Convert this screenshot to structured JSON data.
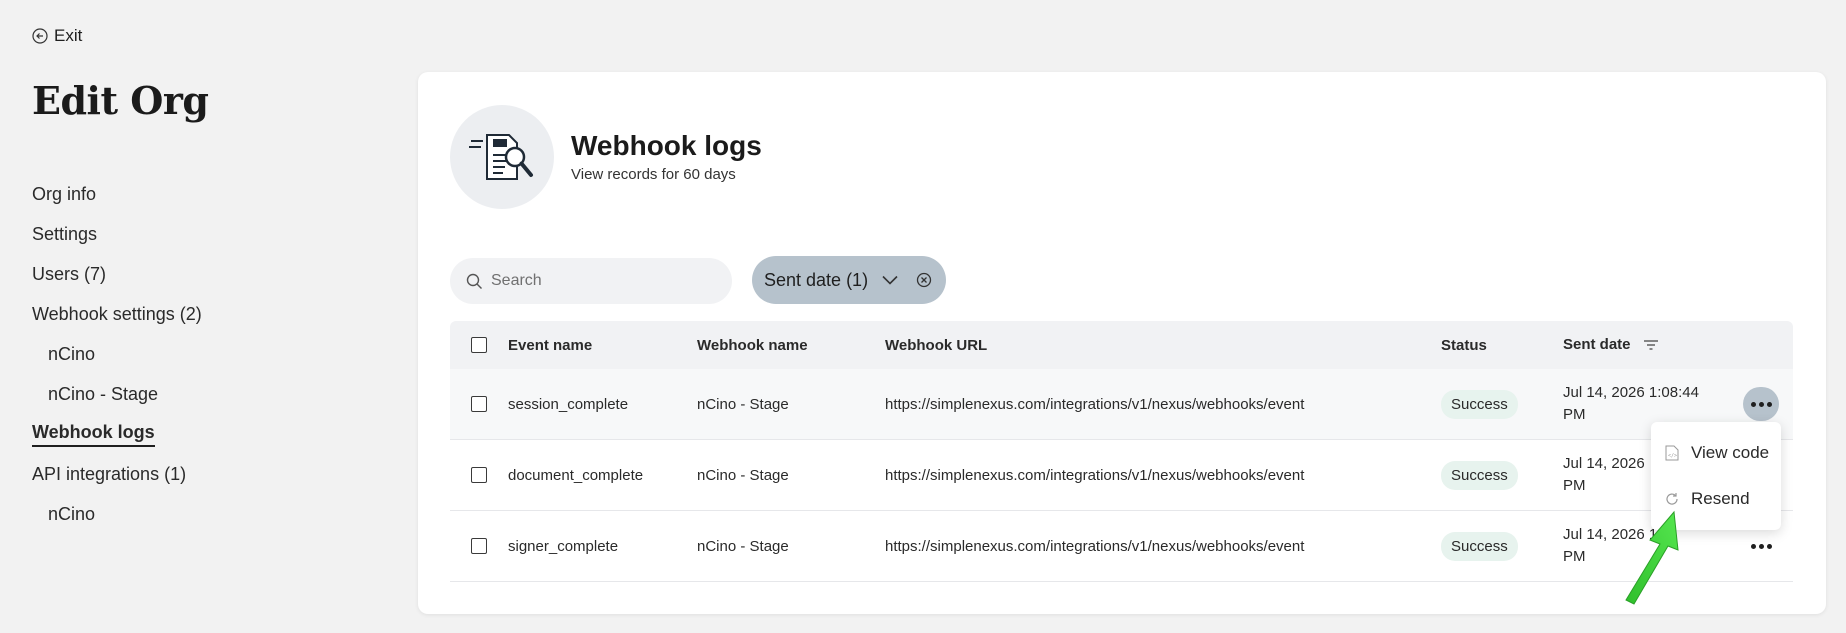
{
  "nav": {
    "exit_label": "Exit",
    "page_title": "Edit Org",
    "items": [
      {
        "label": "Org info",
        "sub": false,
        "active": false
      },
      {
        "label": "Settings",
        "sub": false,
        "active": false
      },
      {
        "label": "Users (7)",
        "sub": false,
        "active": false
      },
      {
        "label": "Webhook settings (2)",
        "sub": false,
        "active": false
      },
      {
        "label": "nCino",
        "sub": true,
        "active": false
      },
      {
        "label": "nCino - Stage",
        "sub": true,
        "active": false
      },
      {
        "label": "Webhook logs",
        "sub": false,
        "active": true
      },
      {
        "label": "API integrations (1)",
        "sub": false,
        "active": false
      },
      {
        "label": "nCino",
        "sub": true,
        "active": false
      }
    ]
  },
  "header": {
    "title": "Webhook logs",
    "subtitle": "View records for 60 days",
    "icon": "document-search-icon"
  },
  "search": {
    "placeholder": "Search",
    "value": ""
  },
  "filter": {
    "label": "Sent date (1)"
  },
  "table": {
    "columns": {
      "event": "Event name",
      "webhook": "Webhook name",
      "url": "Webhook URL",
      "status": "Status",
      "date": "Sent date"
    },
    "rows": [
      {
        "event": "session_complete",
        "webhook": "nCino - Stage",
        "url": "https://simplenexus.com/integrations/v1/nexus/webhooks/event",
        "status": "Success",
        "date_line1": "Jul 14, 2026 1:08:44",
        "date_line2": "PM"
      },
      {
        "event": "document_complete",
        "webhook": "nCino - Stage",
        "url": "https://simplenexus.com/integrations/v1/nexus/webhooks/event",
        "status": "Success",
        "date_line1": "Jul 14, 2026",
        "date_line2": "PM"
      },
      {
        "event": "signer_complete",
        "webhook": "nCino - Stage",
        "url": "https://simplenexus.com/integrations/v1/nexus/webhooks/event",
        "status": "Success",
        "date_line1": "Jul 14, 2026 1:",
        "date_line2": "PM"
      }
    ]
  },
  "menu": {
    "items": [
      {
        "label": "View code",
        "icon": "code-file-icon"
      },
      {
        "label": "Resend",
        "icon": "refresh-icon"
      }
    ]
  },
  "colors": {
    "background": "#f2f2f2",
    "card": "#ffffff",
    "chip": "#b6c2cc",
    "success_badge": "#e7f3ee",
    "arrow": "#3ddc3b"
  }
}
